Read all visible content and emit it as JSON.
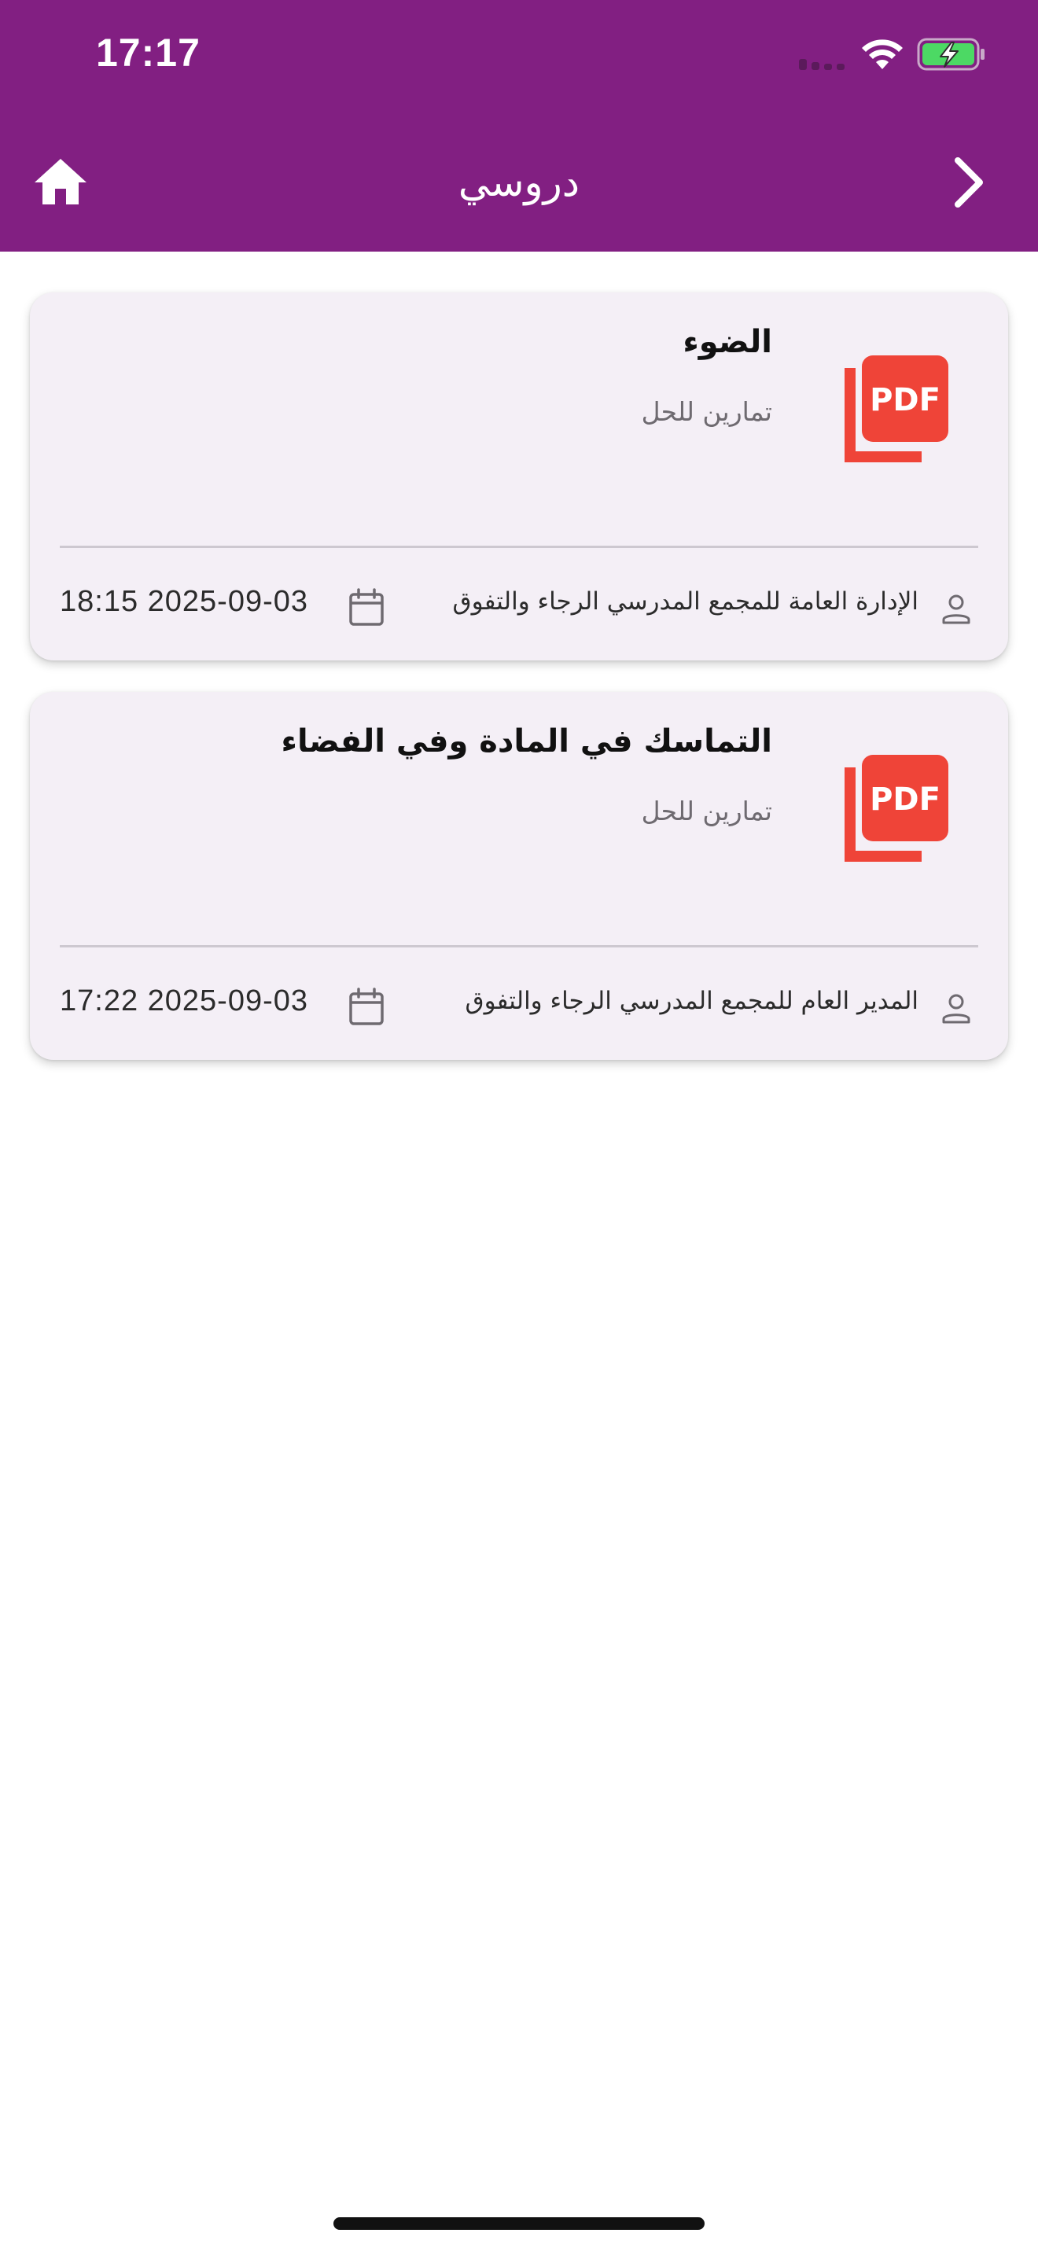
{
  "status_bar": {
    "time": "17:17"
  },
  "app_bar": {
    "title": "دروسي",
    "home_icon": "home-icon",
    "forward_icon": "chevron-right-icon",
    "background_color": "#821F82"
  },
  "lessons": [
    {
      "title": "الضوء",
      "subtitle": "تمارين للحل",
      "author": "الإدارة العامة للمجمع المدرسي الرجاء والتفوق",
      "datetime": "18:15 2025-09-03",
      "file_icon": "pdf-icon"
    },
    {
      "title": "التماسك في المادة وفي الفضاء",
      "subtitle": "تمارين للحل",
      "author": "المدير  العام  للمجمع المدرسي الرجاء والتفوق",
      "datetime": "17:22 2025-09-03",
      "file_icon": "pdf-icon"
    }
  ],
  "colors": {
    "pdf_red": "#EF4438",
    "card_background": "#F4EFF6"
  }
}
